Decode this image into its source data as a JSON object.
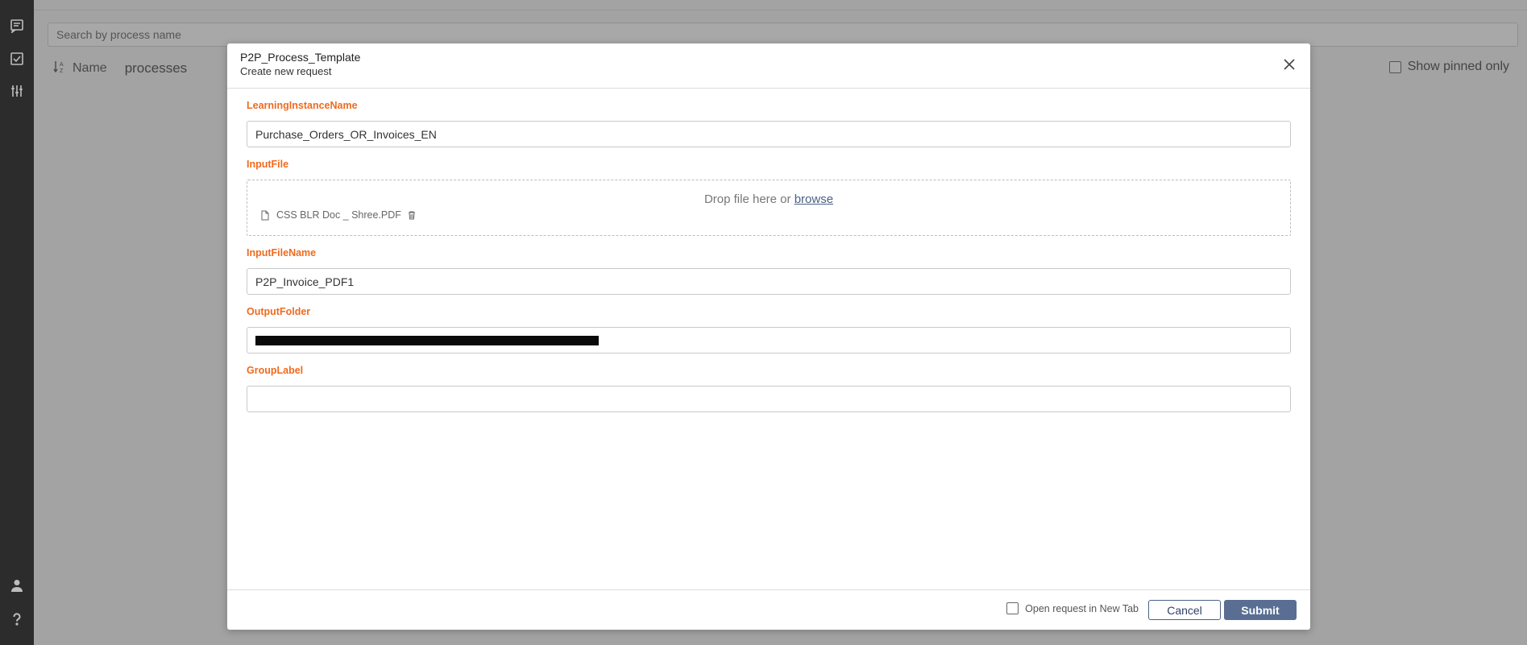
{
  "background": {
    "search_placeholder": "Search by process name",
    "sort_label": "Name",
    "processes_label": "processes",
    "show_pinned_label": "Show pinned only"
  },
  "rail": {
    "icons": [
      "requests-icon",
      "tasks-icon",
      "settings-sliders-icon",
      "user-icon",
      "help-icon"
    ]
  },
  "modal": {
    "title": "P2P_Process_Template",
    "subtitle": "Create new request",
    "fields": {
      "learning_instance": {
        "label": "LearningInstanceName",
        "value": "Purchase_Orders_OR_Invoices_EN"
      },
      "input_file": {
        "label": "InputFile",
        "drop_text": "Drop file here or",
        "browse_label": "browse",
        "file_name": "CSS BLR Doc _ Shree.PDF"
      },
      "input_file_name": {
        "label": "InputFileName",
        "value": "P2P_Invoice_PDF1"
      },
      "output_folder": {
        "label": "OutputFolder",
        "value": ""
      },
      "group_label": {
        "label": "GroupLabel",
        "value": ""
      }
    },
    "footer": {
      "open_new_tab_label": "Open request in New Tab",
      "cancel_label": "Cancel",
      "submit_label": "Submit"
    }
  },
  "colors": {
    "label_orange": "#f06a1d",
    "primary_button": "#596e92",
    "rail_bg": "#2c2c2c"
  }
}
